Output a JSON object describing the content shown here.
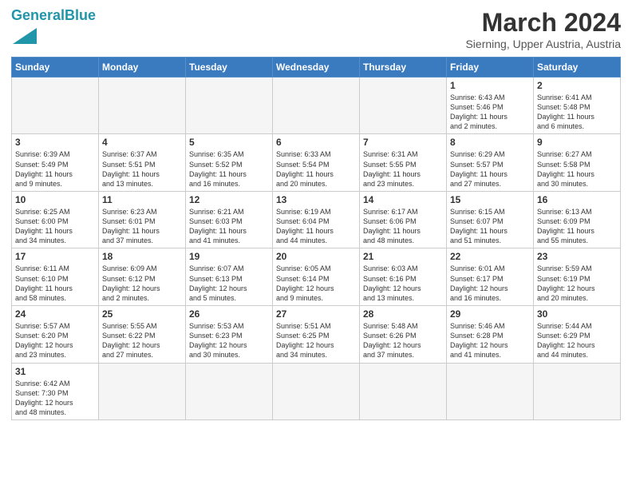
{
  "header": {
    "logo_text_general": "General",
    "logo_text_blue": "Blue",
    "title": "March 2024",
    "subtitle": "Sierning, Upper Austria, Austria"
  },
  "weekdays": [
    "Sunday",
    "Monday",
    "Tuesday",
    "Wednesday",
    "Thursday",
    "Friday",
    "Saturday"
  ],
  "rows": [
    [
      {
        "day": "",
        "info": "",
        "empty": true
      },
      {
        "day": "",
        "info": "",
        "empty": true
      },
      {
        "day": "",
        "info": "",
        "empty": true
      },
      {
        "day": "",
        "info": "",
        "empty": true
      },
      {
        "day": "",
        "info": "",
        "empty": true
      },
      {
        "day": "1",
        "info": "Sunrise: 6:43 AM\nSunset: 5:46 PM\nDaylight: 11 hours\nand 2 minutes.",
        "empty": false
      },
      {
        "day": "2",
        "info": "Sunrise: 6:41 AM\nSunset: 5:48 PM\nDaylight: 11 hours\nand 6 minutes.",
        "empty": false
      }
    ],
    [
      {
        "day": "3",
        "info": "Sunrise: 6:39 AM\nSunset: 5:49 PM\nDaylight: 11 hours\nand 9 minutes.",
        "empty": false
      },
      {
        "day": "4",
        "info": "Sunrise: 6:37 AM\nSunset: 5:51 PM\nDaylight: 11 hours\nand 13 minutes.",
        "empty": false
      },
      {
        "day": "5",
        "info": "Sunrise: 6:35 AM\nSunset: 5:52 PM\nDaylight: 11 hours\nand 16 minutes.",
        "empty": false
      },
      {
        "day": "6",
        "info": "Sunrise: 6:33 AM\nSunset: 5:54 PM\nDaylight: 11 hours\nand 20 minutes.",
        "empty": false
      },
      {
        "day": "7",
        "info": "Sunrise: 6:31 AM\nSunset: 5:55 PM\nDaylight: 11 hours\nand 23 minutes.",
        "empty": false
      },
      {
        "day": "8",
        "info": "Sunrise: 6:29 AM\nSunset: 5:57 PM\nDaylight: 11 hours\nand 27 minutes.",
        "empty": false
      },
      {
        "day": "9",
        "info": "Sunrise: 6:27 AM\nSunset: 5:58 PM\nDaylight: 11 hours\nand 30 minutes.",
        "empty": false
      }
    ],
    [
      {
        "day": "10",
        "info": "Sunrise: 6:25 AM\nSunset: 6:00 PM\nDaylight: 11 hours\nand 34 minutes.",
        "empty": false
      },
      {
        "day": "11",
        "info": "Sunrise: 6:23 AM\nSunset: 6:01 PM\nDaylight: 11 hours\nand 37 minutes.",
        "empty": false
      },
      {
        "day": "12",
        "info": "Sunrise: 6:21 AM\nSunset: 6:03 PM\nDaylight: 11 hours\nand 41 minutes.",
        "empty": false
      },
      {
        "day": "13",
        "info": "Sunrise: 6:19 AM\nSunset: 6:04 PM\nDaylight: 11 hours\nand 44 minutes.",
        "empty": false
      },
      {
        "day": "14",
        "info": "Sunrise: 6:17 AM\nSunset: 6:06 PM\nDaylight: 11 hours\nand 48 minutes.",
        "empty": false
      },
      {
        "day": "15",
        "info": "Sunrise: 6:15 AM\nSunset: 6:07 PM\nDaylight: 11 hours\nand 51 minutes.",
        "empty": false
      },
      {
        "day": "16",
        "info": "Sunrise: 6:13 AM\nSunset: 6:09 PM\nDaylight: 11 hours\nand 55 minutes.",
        "empty": false
      }
    ],
    [
      {
        "day": "17",
        "info": "Sunrise: 6:11 AM\nSunset: 6:10 PM\nDaylight: 11 hours\nand 58 minutes.",
        "empty": false
      },
      {
        "day": "18",
        "info": "Sunrise: 6:09 AM\nSunset: 6:12 PM\nDaylight: 12 hours\nand 2 minutes.",
        "empty": false
      },
      {
        "day": "19",
        "info": "Sunrise: 6:07 AM\nSunset: 6:13 PM\nDaylight: 12 hours\nand 5 minutes.",
        "empty": false
      },
      {
        "day": "20",
        "info": "Sunrise: 6:05 AM\nSunset: 6:14 PM\nDaylight: 12 hours\nand 9 minutes.",
        "empty": false
      },
      {
        "day": "21",
        "info": "Sunrise: 6:03 AM\nSunset: 6:16 PM\nDaylight: 12 hours\nand 13 minutes.",
        "empty": false
      },
      {
        "day": "22",
        "info": "Sunrise: 6:01 AM\nSunset: 6:17 PM\nDaylight: 12 hours\nand 16 minutes.",
        "empty": false
      },
      {
        "day": "23",
        "info": "Sunrise: 5:59 AM\nSunset: 6:19 PM\nDaylight: 12 hours\nand 20 minutes.",
        "empty": false
      }
    ],
    [
      {
        "day": "24",
        "info": "Sunrise: 5:57 AM\nSunset: 6:20 PM\nDaylight: 12 hours\nand 23 minutes.",
        "empty": false
      },
      {
        "day": "25",
        "info": "Sunrise: 5:55 AM\nSunset: 6:22 PM\nDaylight: 12 hours\nand 27 minutes.",
        "empty": false
      },
      {
        "day": "26",
        "info": "Sunrise: 5:53 AM\nSunset: 6:23 PM\nDaylight: 12 hours\nand 30 minutes.",
        "empty": false
      },
      {
        "day": "27",
        "info": "Sunrise: 5:51 AM\nSunset: 6:25 PM\nDaylight: 12 hours\nand 34 minutes.",
        "empty": false
      },
      {
        "day": "28",
        "info": "Sunrise: 5:48 AM\nSunset: 6:26 PM\nDaylight: 12 hours\nand 37 minutes.",
        "empty": false
      },
      {
        "day": "29",
        "info": "Sunrise: 5:46 AM\nSunset: 6:28 PM\nDaylight: 12 hours\nand 41 minutes.",
        "empty": false
      },
      {
        "day": "30",
        "info": "Sunrise: 5:44 AM\nSunset: 6:29 PM\nDaylight: 12 hours\nand 44 minutes.",
        "empty": false
      }
    ],
    [
      {
        "day": "31",
        "info": "Sunrise: 6:42 AM\nSunset: 7:30 PM\nDaylight: 12 hours\nand 48 minutes.",
        "empty": false
      },
      {
        "day": "",
        "info": "",
        "empty": true
      },
      {
        "day": "",
        "info": "",
        "empty": true
      },
      {
        "day": "",
        "info": "",
        "empty": true
      },
      {
        "day": "",
        "info": "",
        "empty": true
      },
      {
        "day": "",
        "info": "",
        "empty": true
      },
      {
        "day": "",
        "info": "",
        "empty": true
      }
    ]
  ]
}
